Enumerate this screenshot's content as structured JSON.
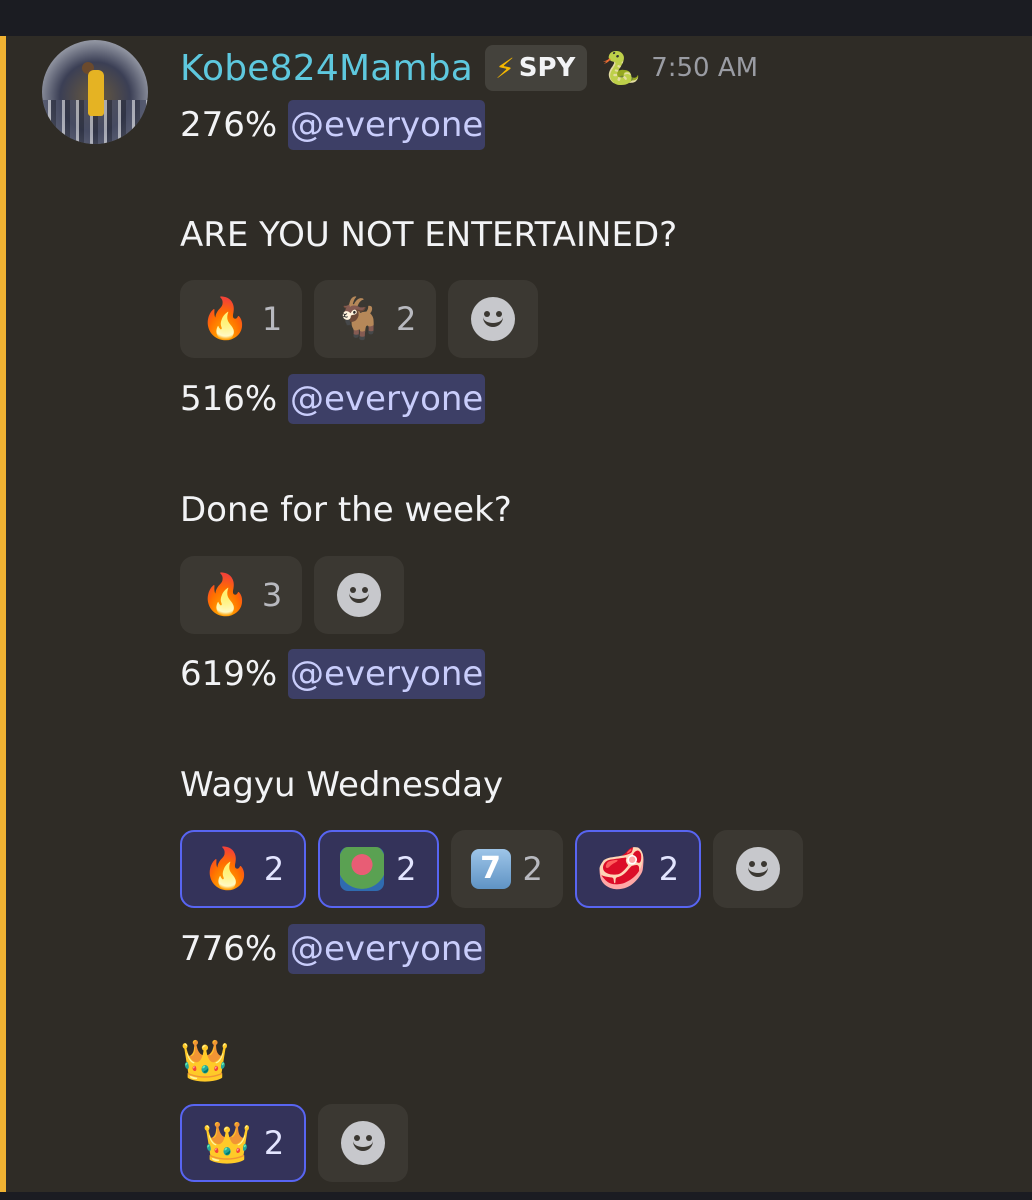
{
  "header": {
    "username": "Kobe824Mamba",
    "tag_icon": "⚡",
    "tag_label": "SPY",
    "badge_emoji": "🐍",
    "timestamp": "7:50 AM"
  },
  "messages": [
    {
      "percent": "276%",
      "mention": "@everyone",
      "text": "ARE YOU NOT ENTERTAINED?",
      "reactions": [
        {
          "emoji": "🔥",
          "count": "1",
          "me": false
        },
        {
          "emoji": "🐐",
          "count": "2",
          "me": false
        }
      ]
    },
    {
      "percent": "516%",
      "mention": "@everyone",
      "text": "Done for the week?",
      "reactions": [
        {
          "emoji": "🔥",
          "count": "3",
          "me": false
        }
      ]
    },
    {
      "percent": "619%",
      "mention": "@everyone",
      "text": "Wagyu Wednesday",
      "reactions": [
        {
          "emoji": "🔥",
          "count": "2",
          "me": true
        },
        {
          "emoji": "pepe-scream-icon",
          "count": "2",
          "me": true
        },
        {
          "emoji": "7",
          "count": "2",
          "me": false
        },
        {
          "emoji": "🥩",
          "count": "2",
          "me": true
        }
      ]
    },
    {
      "percent": "776%",
      "mention": "@everyone",
      "text": "👑",
      "reactions": [
        {
          "emoji": "👑",
          "count": "2",
          "me": true
        }
      ]
    }
  ],
  "colors": {
    "username": "#5ec8de",
    "highlight": "#f0b232",
    "mention_bg": "#3d3f66",
    "reacted_border": "#5865f2"
  }
}
